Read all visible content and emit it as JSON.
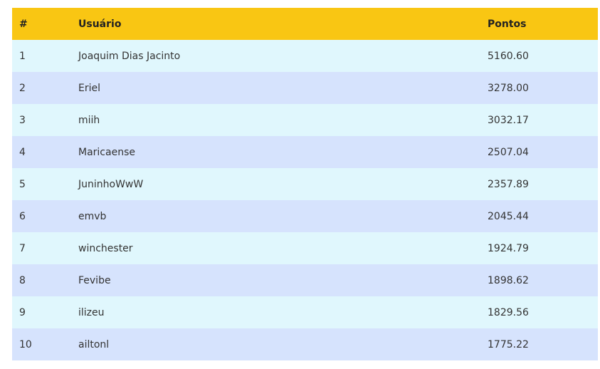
{
  "colors": {
    "header_bg": "#f9c613",
    "row_odd_bg": "#e0f7fd",
    "row_even_bg": "#d6e3fd"
  },
  "table": {
    "headers": {
      "rank": "#",
      "user": "Usuário",
      "points": "Pontos"
    },
    "rows": [
      {
        "rank": "1",
        "user": "Joaquim Dias Jacinto",
        "points": "5160.60"
      },
      {
        "rank": "2",
        "user": "Eriel",
        "points": "3278.00"
      },
      {
        "rank": "3",
        "user": "miih",
        "points": "3032.17"
      },
      {
        "rank": "4",
        "user": "Maricaense",
        "points": "2507.04"
      },
      {
        "rank": "5",
        "user": "JuninhoWwW",
        "points": "2357.89"
      },
      {
        "rank": "6",
        "user": "emvb",
        "points": "2045.44"
      },
      {
        "rank": "7",
        "user": "winchester",
        "points": "1924.79"
      },
      {
        "rank": "8",
        "user": "Fevibe",
        "points": "1898.62"
      },
      {
        "rank": "9",
        "user": "ilizeu",
        "points": "1829.56"
      },
      {
        "rank": "10",
        "user": "ailtonl",
        "points": "1775.22"
      }
    ]
  }
}
